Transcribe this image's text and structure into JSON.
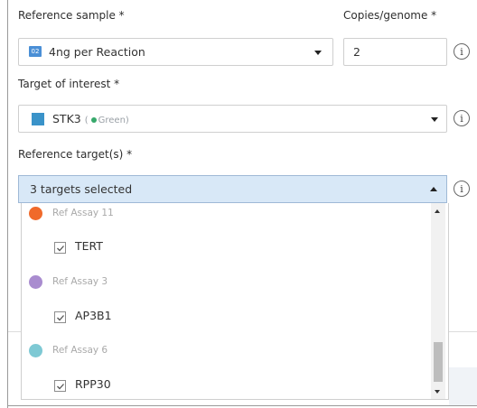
{
  "reference_sample": {
    "label": "Reference sample *",
    "badge": "02",
    "value": "4ng per Reaction"
  },
  "copies_per_genome": {
    "label": "Copies/genome *",
    "value": "2"
  },
  "target_of_interest": {
    "label": "Target of interest *",
    "value": "STK3",
    "color_name": "Green",
    "color": "#3a93c9"
  },
  "reference_targets": {
    "label": "Reference target(s) *",
    "summary": "3 targets selected",
    "groups": [
      {
        "group_label": "Ref Assay 11",
        "color": "#f06a2b",
        "item": "TERT",
        "checked": true
      },
      {
        "group_label": "Ref Assay 3",
        "color": "#a98ccf",
        "item": "AP3B1",
        "checked": true
      },
      {
        "group_label": "Ref Assay 6",
        "color": "#7ec9d4",
        "item": "RPP30",
        "checked": true
      }
    ]
  },
  "info_icon_glyph": "i"
}
